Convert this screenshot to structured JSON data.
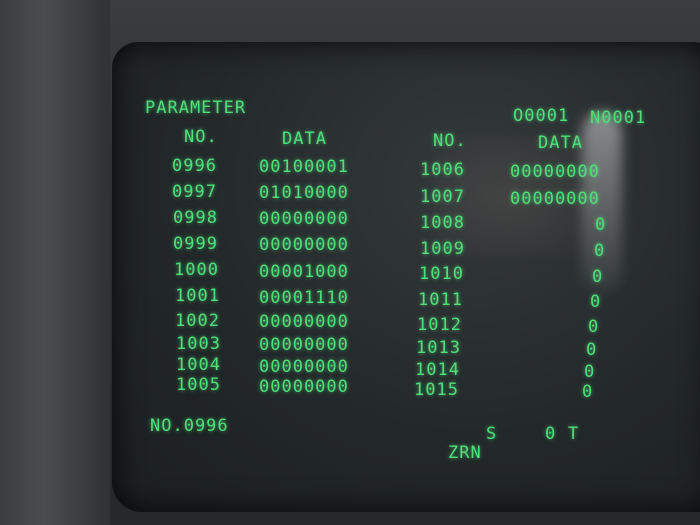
{
  "screen": {
    "mode_title": "PARAMETER",
    "program_number": "O0001",
    "sequence_number": "N0001",
    "col_no_label": "NO.",
    "col_data_label": "DATA",
    "left_rows": [
      {
        "no": "0996",
        "data": "00100001"
      },
      {
        "no": "0997",
        "data": "01010000"
      },
      {
        "no": "0998",
        "data": "00000000"
      },
      {
        "no": "0999",
        "data": "00000000"
      },
      {
        "no": "1000",
        "data": "00001000"
      },
      {
        "no": "1001",
        "data": "00001110"
      },
      {
        "no": "1002",
        "data": "00000000"
      },
      {
        "no": "1003",
        "data": "00000000"
      },
      {
        "no": "1004",
        "data": "00000000"
      },
      {
        "no": "1005",
        "data": "00000000"
      }
    ],
    "right_rows": [
      {
        "no": "1006",
        "data": "00000000"
      },
      {
        "no": "1007",
        "data": "00000000"
      },
      {
        "no": "1008",
        "data": "0"
      },
      {
        "no": "1009",
        "data": "0"
      },
      {
        "no": "1010",
        "data": "0"
      },
      {
        "no": "1011",
        "data": "0"
      },
      {
        "no": "1012",
        "data": "0"
      },
      {
        "no": "1013",
        "data": "0"
      },
      {
        "no": "1014",
        "data": "0"
      },
      {
        "no": "1015",
        "data": "0"
      }
    ],
    "input_line": "NO.0996",
    "status_s": "S",
    "status_s_value": "0",
    "status_t": "T",
    "status_mode": "ZRN"
  }
}
